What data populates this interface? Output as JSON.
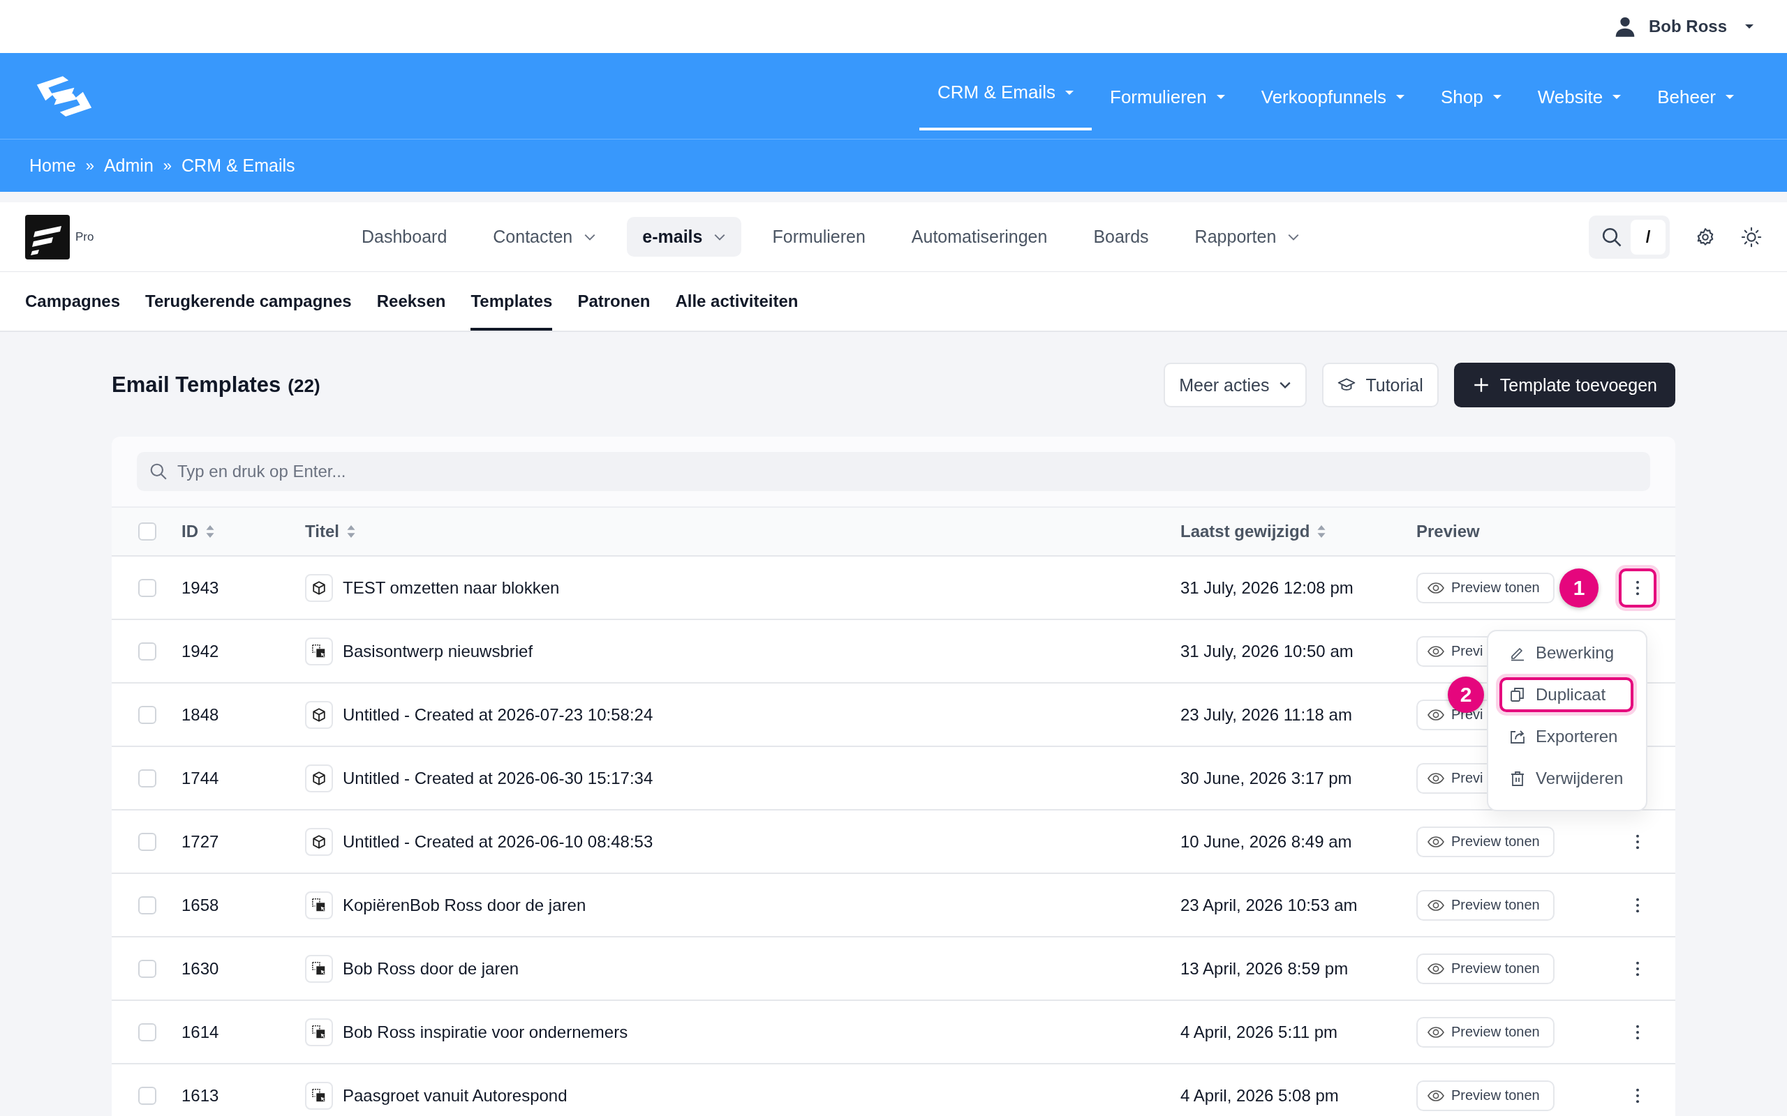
{
  "user": {
    "name": "Bob Ross"
  },
  "main_nav": [
    {
      "label": "CRM & Emails",
      "selected": true,
      "dropdown": true
    },
    {
      "label": "Formulieren",
      "selected": false,
      "dropdown": true
    },
    {
      "label": "Verkoopfunnels",
      "selected": false,
      "dropdown": true
    },
    {
      "label": "Shop",
      "selected": false,
      "dropdown": true
    },
    {
      "label": "Website",
      "selected": false,
      "dropdown": true
    },
    {
      "label": "Beheer",
      "selected": false,
      "dropdown": true
    }
  ],
  "breadcrumb": [
    {
      "kind": "link",
      "text": "Home"
    },
    {
      "kind": "separator",
      "text": "»"
    },
    {
      "kind": "link",
      "text": "Admin"
    },
    {
      "kind": "separator",
      "text": "»"
    },
    {
      "kind": "link",
      "text": "CRM & Emails"
    }
  ],
  "app": {
    "plan": "Pro",
    "search_key": "/",
    "nav": [
      {
        "label": "Dashboard",
        "selected": false,
        "dropdown": false
      },
      {
        "label": "Contacten",
        "selected": false,
        "dropdown": true
      },
      {
        "label": "e-mails",
        "selected": true,
        "dropdown": true
      },
      {
        "label": "Formulieren",
        "selected": false,
        "dropdown": false
      },
      {
        "label": "Automatiseringen",
        "selected": false,
        "dropdown": false
      },
      {
        "label": "Boards",
        "selected": false,
        "dropdown": false
      },
      {
        "label": "Rapporten",
        "selected": false,
        "dropdown": true
      }
    ]
  },
  "subtabs": [
    {
      "label": "Campagnes",
      "selected": false
    },
    {
      "label": "Terugkerende campagnes",
      "selected": false
    },
    {
      "label": "Reeksen",
      "selected": false
    },
    {
      "label": "Templates",
      "selected": true
    },
    {
      "label": "Patronen",
      "selected": false
    },
    {
      "label": "Alle activiteiten",
      "selected": false
    }
  ],
  "page": {
    "title": "Email Templates",
    "count": "(22)",
    "buttons": [
      {
        "kind": "dropdown",
        "label": "Meer acties"
      },
      {
        "kind": "tutorial",
        "label": "Tutorial"
      },
      {
        "kind": "primary",
        "label": "Template toevoegen"
      }
    ]
  },
  "search": {
    "placeholder": "Typ en druk op Enter..."
  },
  "table": {
    "all_checked": false,
    "columns": [
      {
        "label": "ID",
        "sortable": true
      },
      {
        "label": "Titel",
        "sortable": true
      },
      {
        "label": "Laatst gewijzigd",
        "sortable": true
      },
      {
        "label": "Preview",
        "sortable": false
      }
    ],
    "rows": [
      {
        "id": "1943",
        "kind": "blocks",
        "title": "TEST omzetten naar blokken",
        "modified": "31 July, 2026 12:08 pm",
        "preview": "Preview tonen",
        "checked": false,
        "callout": "1",
        "menu": {
          "button_highlighted": true,
          "items": [
            {
              "kind": "edit",
              "label": "Bewerking",
              "highlighted": false
            },
            {
              "kind": "duplicate",
              "label": "Duplicaat",
              "highlighted": true,
              "callout": "2"
            },
            {
              "kind": "export",
              "label": "Exporteren",
              "highlighted": false
            },
            {
              "kind": "delete",
              "label": "Verwijderen",
              "highlighted": false
            }
          ]
        }
      },
      {
        "id": "1942",
        "kind": "layout",
        "title": "Basisontwerp nieuwsbrief",
        "modified": "31 July, 2026 10:50 am",
        "preview": "Previ",
        "checked": false
      },
      {
        "id": "1848",
        "kind": "blocks",
        "title": "Untitled - Created at 2026-07-23 10:58:24",
        "modified": "23 July, 2026 11:18 am",
        "preview": "Previ",
        "checked": false
      },
      {
        "id": "1744",
        "kind": "blocks",
        "title": "Untitled - Created at 2026-06-30 15:17:34",
        "modified": "30 June, 2026 3:17 pm",
        "preview": "Previ",
        "checked": false
      },
      {
        "id": "1727",
        "kind": "blocks",
        "title": "Untitled - Created at 2026-06-10 08:48:53",
        "modified": "10 June, 2026 8:49 am",
        "preview": "Preview tonen",
        "checked": false
      },
      {
        "id": "1658",
        "kind": "layout",
        "title": "KopiërenBob Ross door de jaren",
        "modified": "23 April, 2026 10:53 am",
        "preview": "Preview tonen",
        "checked": false
      },
      {
        "id": "1630",
        "kind": "layout",
        "title": "Bob Ross door de jaren",
        "modified": "13 April, 2026 8:59 pm",
        "preview": "Preview tonen",
        "checked": false
      },
      {
        "id": "1614",
        "kind": "layout",
        "title": "Bob Ross inspiratie voor ondernemers",
        "modified": "4 April, 2026 5:11 pm",
        "preview": "Preview tonen",
        "checked": false
      },
      {
        "id": "1613",
        "kind": "layout",
        "title": "Paasgroet vanuit Autorespond",
        "modified": "4 April, 2026 5:08 pm",
        "preview": "Preview tonen",
        "checked": false
      }
    ]
  }
}
